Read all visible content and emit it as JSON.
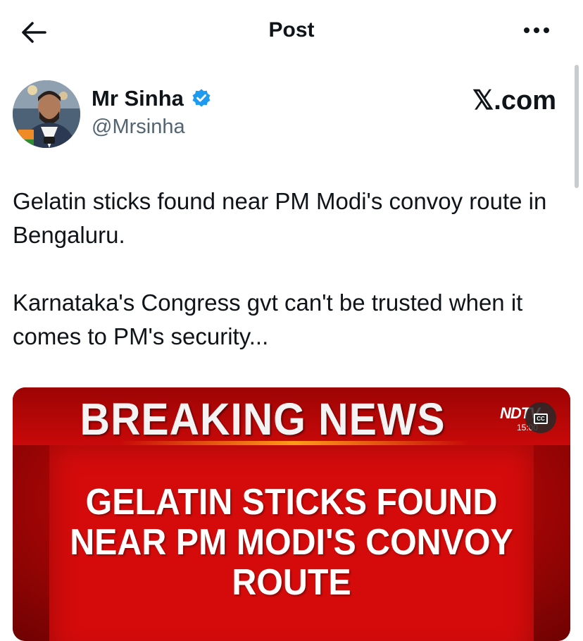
{
  "header": {
    "title": "Post"
  },
  "author": {
    "name": "Mr Sinha",
    "handle": "@Mrsinha",
    "verified_color": "#1d9bf0"
  },
  "watermark": "𝕏.com",
  "post": {
    "paragraphs": [
      "Gelatin sticks found near PM Modi's convoy route in Bengaluru.",
      "Karnataka's Congress gvt can't be trusted when it comes to PM's security..."
    ]
  },
  "media": {
    "banner": "BREAKING NEWS",
    "headline": "GELATIN STICKS FOUND NEAR PM MODI'S CONVOY ROUTE",
    "channel": "NDTV",
    "time": "15:00",
    "cc_label": "CC"
  },
  "icons": {
    "back": "arrow-left-icon",
    "more": "more-horizontal-icon",
    "verified": "verified-badge-icon",
    "captions": "closed-captions-icon"
  }
}
